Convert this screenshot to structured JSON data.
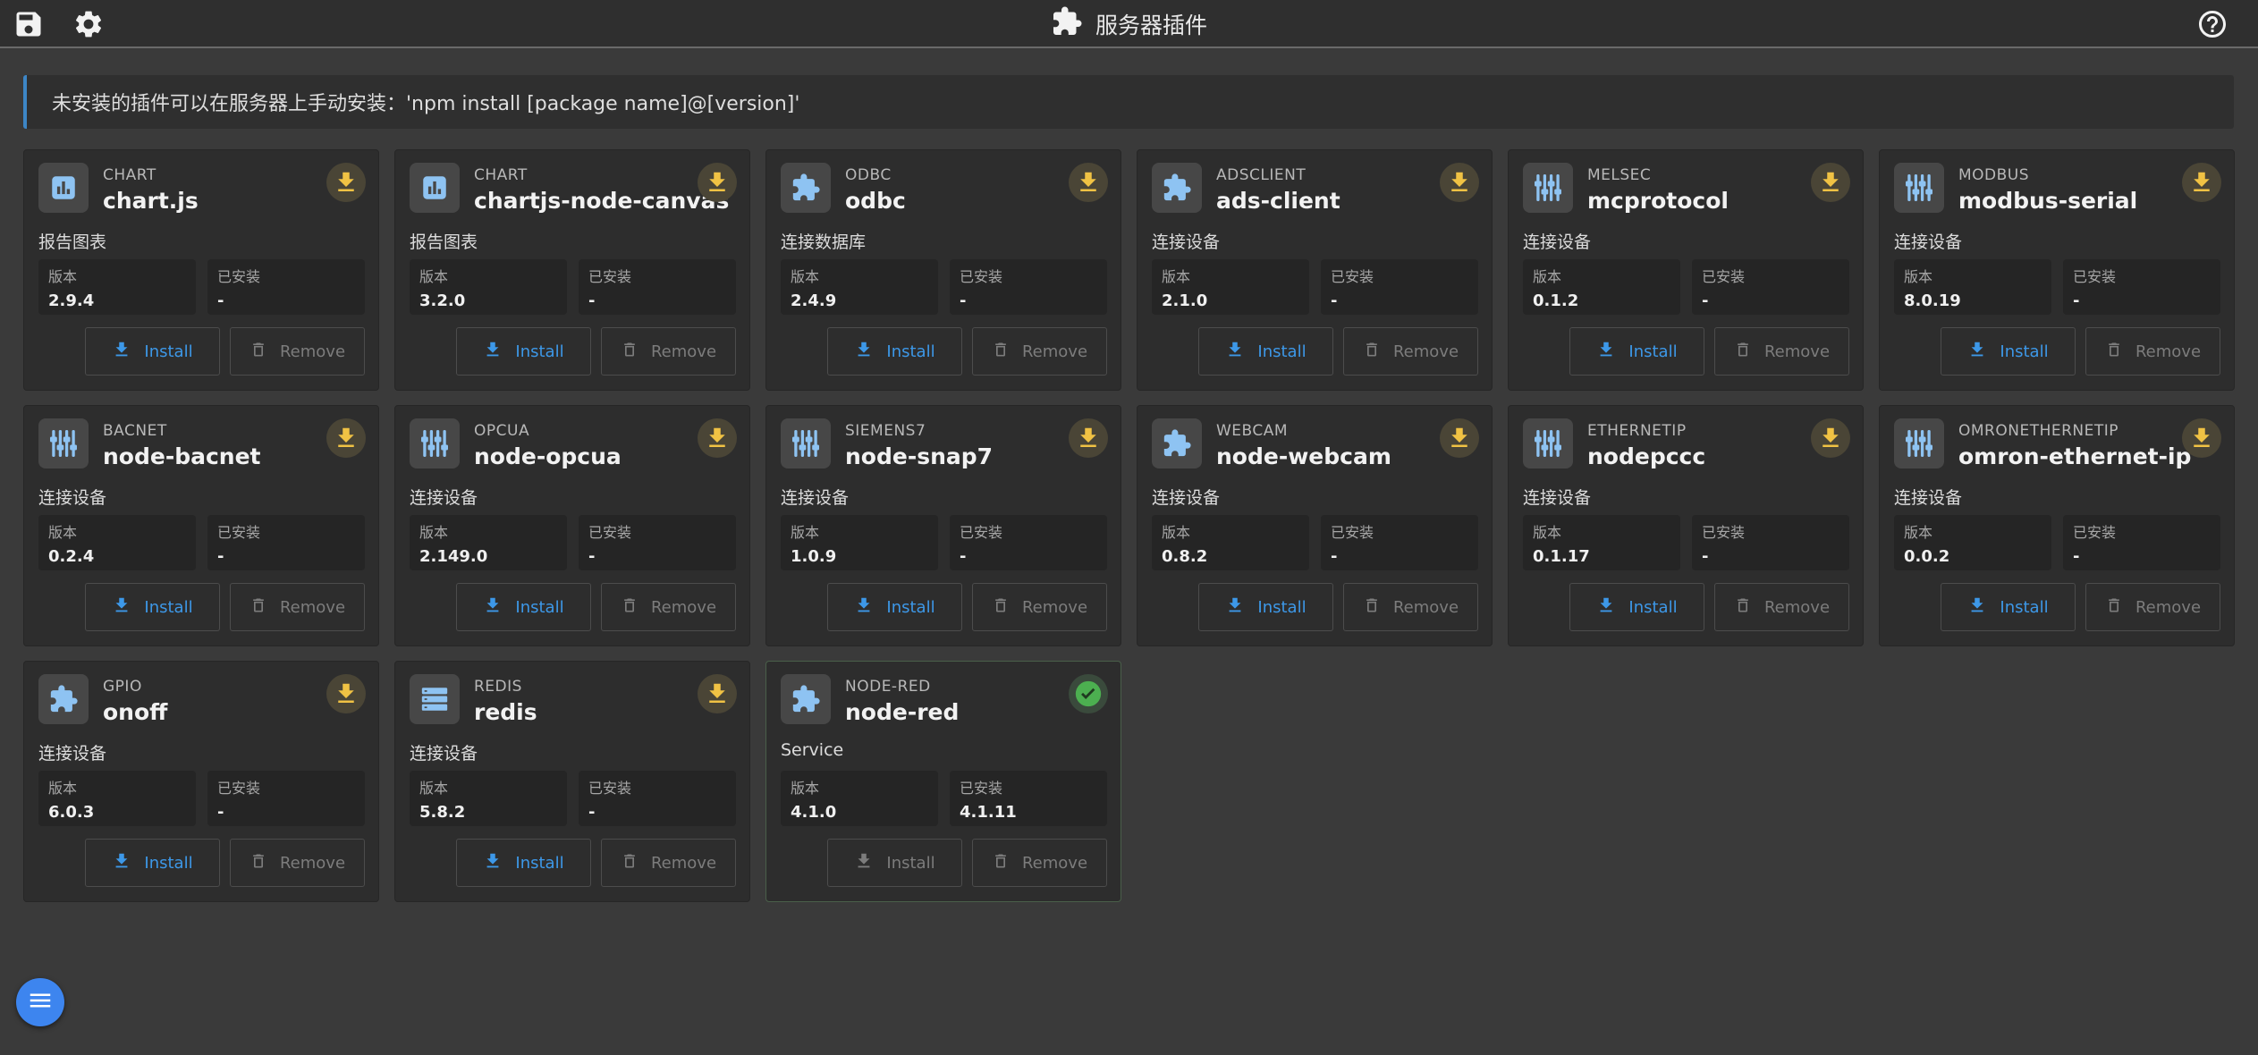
{
  "header": {
    "title": "服务器插件"
  },
  "notice": "未安装的插件可以在服务器上手动安装：'npm install [package name]@[version]'",
  "labels": {
    "version": "版本",
    "installed": "已安装",
    "install": "Install",
    "remove": "Remove"
  },
  "plugins": [
    {
      "category": "CHART",
      "name": "chart.js",
      "desc": "报告图表",
      "version": "2.9.4",
      "installed": "-",
      "icon": "chart-icon",
      "status": "downloadable"
    },
    {
      "category": "CHART",
      "name": "chartjs-node-canvas",
      "desc": "报告图表",
      "version": "3.2.0",
      "installed": "-",
      "icon": "chart-icon",
      "status": "downloadable"
    },
    {
      "category": "ODBC",
      "name": "odbc",
      "desc": "连接数据库",
      "version": "2.4.9",
      "installed": "-",
      "icon": "puzzle-icon",
      "status": "downloadable"
    },
    {
      "category": "ADSCLIENT",
      "name": "ads-client",
      "desc": "连接设备",
      "version": "2.1.0",
      "installed": "-",
      "icon": "puzzle-icon",
      "status": "downloadable"
    },
    {
      "category": "MELSEC",
      "name": "mcprotocol",
      "desc": "连接设备",
      "version": "0.1.2",
      "installed": "-",
      "icon": "device-icon",
      "status": "downloadable"
    },
    {
      "category": "MODBUS",
      "name": "modbus-serial",
      "desc": "连接设备",
      "version": "8.0.19",
      "installed": "-",
      "icon": "device-icon",
      "status": "downloadable"
    },
    {
      "category": "BACNET",
      "name": "node-bacnet",
      "desc": "连接设备",
      "version": "0.2.4",
      "installed": "-",
      "icon": "device-icon",
      "status": "downloadable"
    },
    {
      "category": "OPCUA",
      "name": "node-opcua",
      "desc": "连接设备",
      "version": "2.149.0",
      "installed": "-",
      "icon": "device-icon",
      "status": "downloadable"
    },
    {
      "category": "SIEMENS7",
      "name": "node-snap7",
      "desc": "连接设备",
      "version": "1.0.9",
      "installed": "-",
      "icon": "device-icon",
      "status": "downloadable"
    },
    {
      "category": "WEBCAM",
      "name": "node-webcam",
      "desc": "连接设备",
      "version": "0.8.2",
      "installed": "-",
      "icon": "puzzle-icon",
      "status": "downloadable"
    },
    {
      "category": "ETHERNETIP",
      "name": "nodepccc",
      "desc": "连接设备",
      "version": "0.1.17",
      "installed": "-",
      "icon": "device-icon",
      "status": "downloadable"
    },
    {
      "category": "OMRONETHERNETIP",
      "name": "omron-ethernet-ip",
      "desc": "连接设备",
      "version": "0.0.2",
      "installed": "-",
      "icon": "device-icon",
      "status": "downloadable"
    },
    {
      "category": "GPIO",
      "name": "onoff",
      "desc": "连接设备",
      "version": "6.0.3",
      "installed": "-",
      "icon": "puzzle-icon",
      "status": "downloadable"
    },
    {
      "category": "REDIS",
      "name": "redis",
      "desc": "连接设备",
      "version": "5.8.2",
      "installed": "-",
      "icon": "storage-icon",
      "status": "downloadable"
    },
    {
      "category": "NODE-RED",
      "name": "node-red",
      "desc": "Service",
      "version": "4.1.0",
      "installed": "4.1.11",
      "icon": "puzzle-icon",
      "status": "installed"
    }
  ],
  "colors": {
    "accent": "#3d98e8",
    "download": "#f0c244",
    "installed": "#4caf50",
    "fab": "#3d85ef"
  }
}
